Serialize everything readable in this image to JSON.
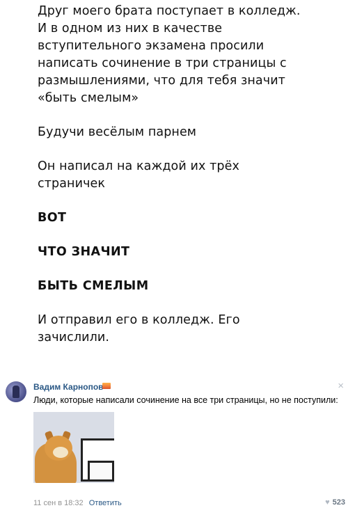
{
  "post": {
    "paragraph1": [
      "Друг моего брата поступает в колледж.",
      "И в одном из них в качестве",
      "вступительного экзамена просили",
      "написать сочинение в три страницы с",
      "размышлениями, что для тебя значит",
      "«быть смелым»"
    ],
    "paragraph2": "Будучи весёлым парнем",
    "paragraph3": [
      "Он написал на каждой их трёх",
      "страничек"
    ],
    "caps1": "ВОТ",
    "caps2": "ЧТО ЗНАЧИТ",
    "caps3": "БЫТЬ СМЕЛЫМ",
    "paragraph4": [
      "И отправил его в колледж. Его",
      "зачислили."
    ]
  },
  "comment": {
    "author": "Вадим Карнопов",
    "text": "Люди, которые написали сочинение на все три страницы, но не поступили:",
    "timestamp": "11 сен в 18:32",
    "reply_label": "Ответить",
    "likes": "523",
    "close_icon": "×",
    "heart_icon": "♥"
  },
  "colors": {
    "link": "#2a5885",
    "meta": "#939393"
  }
}
